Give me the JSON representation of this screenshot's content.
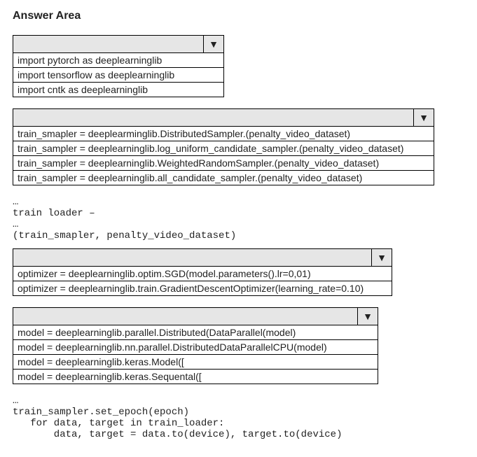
{
  "title": "Answer Area",
  "dropdowns": [
    {
      "options": [
        "import pytorch as deeplearninglib",
        "import tensorflow as deeplearninglib",
        "import cntk as deeplearninglib"
      ]
    },
    {
      "options": [
        "train_smapler = deeplearminglib.DistributedSampler.(penalty_video_dataset)",
        "train_sampler = deeplearninglib.log_uniform_candidate_sampler.(penalty_video_dataset)",
        "train_sampler = deeplearninglib.WeightedRandomSampler.(penalty_video_dataset)",
        "train_sampler = deeplearninglib.all_candidate_sampler.(penalty_video_dataset)"
      ]
    },
    {
      "options": [
        "optimizer = deeplearninglib.optim.SGD(model.parameters().lr=0,01)",
        "optimizer = deeplearninglib.train.GradientDescentOptimizer(learning_rate=0.10)"
      ]
    },
    {
      "options": [
        "model = deeplearninglib.parallel.Distributed(DataParallel(model)",
        "model = deeplearninglib.nn.parallel.DistributedDataParallelCPU(model)",
        "model = deeplearninglib.keras.Model([",
        "model = deeplearninglib.keras.Sequental(["
      ]
    }
  ],
  "code_after_dd2": "…\ntrain loader –\n…\n(train_smapler, penalty_video_dataset)",
  "code_after_dd4": "…\ntrain_sampler.set_epoch(epoch)\n   for data, target in train_loader:\n       data, target = data.to(device), target.to(device)"
}
